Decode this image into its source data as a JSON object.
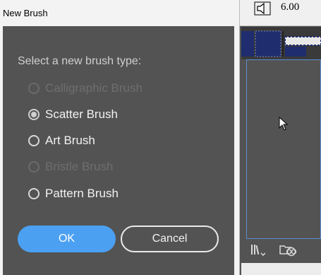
{
  "background_app": {
    "volume_value": "6.00",
    "icons": {
      "speaker": "speaker-icon",
      "libraries": "libraries-icon",
      "creative_cloud": "creative-cloud-icon",
      "cursor": "mouse-pointer-icon"
    }
  },
  "dialog": {
    "title": "New Brush",
    "prompt": "Select a new brush type:",
    "options": [
      {
        "label": "Calligraphic Brush",
        "enabled": false,
        "checked": false
      },
      {
        "label": "Scatter Brush",
        "enabled": true,
        "checked": true
      },
      {
        "label": "Art Brush",
        "enabled": true,
        "checked": false
      },
      {
        "label": "Bristle Brush",
        "enabled": false,
        "checked": false
      },
      {
        "label": "Pattern Brush",
        "enabled": true,
        "checked": false
      }
    ],
    "buttons": {
      "ok": "OK",
      "cancel": "Cancel"
    }
  },
  "colors": {
    "dialog_body": "#535353",
    "accent_button": "#4ba0f2",
    "panel_border": "#5a8fd0"
  }
}
